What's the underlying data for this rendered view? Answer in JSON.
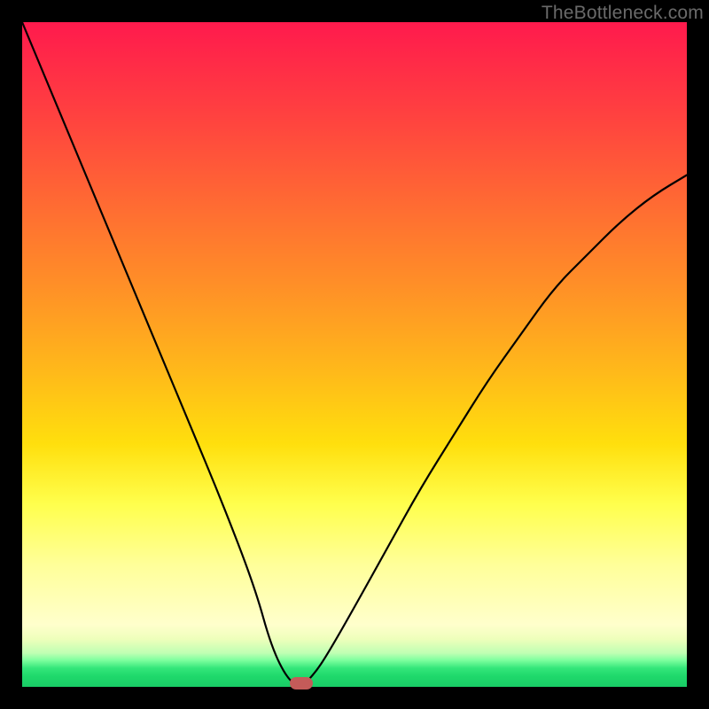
{
  "watermark": "TheBottleneck.com",
  "colors": {
    "frame": "#000000",
    "marker": "#c45b59",
    "curve": "#000000"
  },
  "chart_data": {
    "type": "line",
    "title": "",
    "xlabel": "",
    "ylabel": "",
    "xlim": [
      0,
      100
    ],
    "ylim": [
      0,
      100
    ],
    "grid": false,
    "legend": null,
    "series": [
      {
        "name": "bottleneck-curve",
        "x": [
          0,
          5,
          10,
          15,
          20,
          25,
          30,
          35,
          37.5,
          40,
          42,
          44,
          46,
          50,
          55,
          60,
          65,
          70,
          75,
          80,
          85,
          90,
          95,
          100
        ],
        "values": [
          100,
          88,
          76,
          64,
          52,
          40,
          28,
          15,
          6,
          1,
          0,
          2,
          5,
          12,
          21,
          30,
          38,
          46,
          53,
          60,
          65,
          70,
          74,
          77
        ]
      }
    ],
    "marker": {
      "x": 42,
      "y": 0.5
    },
    "background_bands": [
      {
        "from_y": 100,
        "to_y": 9.3,
        "style": "red-to-yellow-gradient"
      },
      {
        "from_y": 9.3,
        "to_y": 4.0,
        "style": "pale-yellow-to-light-green"
      },
      {
        "from_y": 4.0,
        "to_y": 0.0,
        "style": "green"
      }
    ]
  }
}
